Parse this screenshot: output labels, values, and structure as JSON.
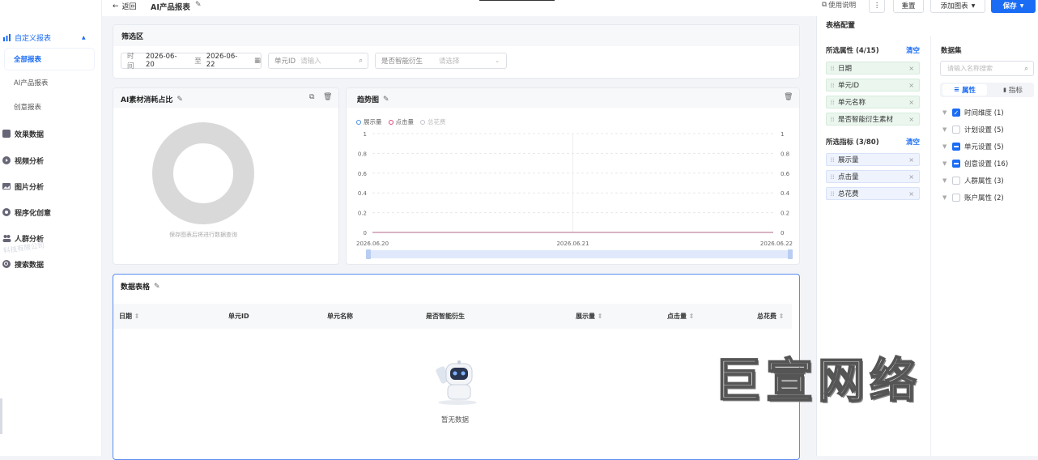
{
  "topbar": {
    "back_label": "返回",
    "report_title": "AI产品报表",
    "help_label": "使用说明",
    "more_label": "⋮",
    "reset_label": "重置",
    "add_chart_label": "添加图表",
    "save_label": "保存"
  },
  "sidebar": {
    "group_title": "自定义报表",
    "sub_items": [
      {
        "label": "全部报表",
        "active": true
      },
      {
        "label": "AI产品报表",
        "active": false
      },
      {
        "label": "创意报表",
        "active": false
      }
    ],
    "items": [
      {
        "label": "效果数据",
        "icon": "chart-icon"
      },
      {
        "label": "视频分析",
        "icon": "video-icon"
      },
      {
        "label": "图片分析",
        "icon": "image-icon"
      },
      {
        "label": "程序化创意",
        "icon": "program-icon"
      },
      {
        "label": "人群分析",
        "icon": "people-icon"
      },
      {
        "label": "搜索数据",
        "icon": "search-icon"
      }
    ],
    "faint_text": "科技有限公司"
  },
  "filter": {
    "title": "筛选区",
    "time_label": "时间",
    "date_start": "2026-06-20",
    "date_sep": "至",
    "date_end": "2026-06-22",
    "unit_id_label": "单元ID",
    "unit_id_placeholder": "请输入",
    "derived_label": "是否智能衍生",
    "derived_placeholder": "请选择"
  },
  "donut_card": {
    "title": "AI素材消耗占比",
    "caption": "保存图表后将进行数据查询"
  },
  "trend_card": {
    "title": "趋势图",
    "legend": [
      {
        "label": "展示量",
        "color": "#4a90e2"
      },
      {
        "label": "点击量",
        "color": "#e0457b"
      },
      {
        "label": "总花费",
        "color": "#c0c4cc"
      }
    ]
  },
  "chart_data": {
    "type": "line",
    "title": "趋势图",
    "x": [
      "2026.06.20",
      "2026.06.21",
      "2026.06.22"
    ],
    "series": [
      {
        "name": "展示量",
        "values": [
          0,
          0,
          0
        ]
      },
      {
        "name": "点击量",
        "values": [
          0,
          0,
          0
        ]
      },
      {
        "name": "总花费",
        "values": [
          0,
          0,
          0
        ]
      }
    ],
    "yticks_left": [
      "1",
      "0.8",
      "0.6",
      "0.4",
      "0.2",
      "0"
    ],
    "yticks_right": [
      "1",
      "0.8",
      "0.6",
      "0.4",
      "0.2",
      "0"
    ],
    "ylim": [
      0,
      1
    ],
    "grid": true,
    "legend_position": "top-left"
  },
  "table": {
    "title": "数据表格",
    "columns": [
      "日期",
      "单元ID",
      "单元名称",
      "是否智能衍生",
      "展示量",
      "点击量",
      "总花费"
    ],
    "empty_text": "暂无数据"
  },
  "config": {
    "title": "表格配置",
    "attrs_label": "所选属性 (4/15)",
    "clear_label": "清空",
    "attrs": [
      "日期",
      "单元ID",
      "单元名称",
      "是否智能衍生素材"
    ],
    "metrics_label": "所选指标 (3/80)",
    "metrics": [
      "展示量",
      "点击量",
      "总花费"
    ],
    "dataset_label": "数据集",
    "search_placeholder": "请输入名称搜索",
    "tab_attr": "属性",
    "tab_metric": "指标",
    "tree": [
      {
        "label": "时间维度 (1)",
        "state": "checked"
      },
      {
        "label": "计划设置 (5)",
        "state": "empty"
      },
      {
        "label": "单元设置 (5)",
        "state": "partial"
      },
      {
        "label": "创意设置 (16)",
        "state": "partial"
      },
      {
        "label": "人群属性 (3)",
        "state": "empty"
      },
      {
        "label": "账户属性 (2)",
        "state": "empty"
      }
    ]
  },
  "watermark": "巨宣网络"
}
